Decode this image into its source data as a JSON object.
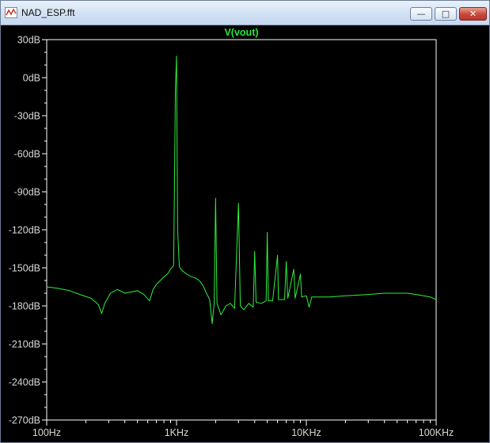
{
  "window": {
    "title": "NAD_ESP.fft",
    "minimize": "—",
    "maximize": "□",
    "close": "✕",
    "icon": "waveform-plot-icon"
  },
  "chart_data": {
    "type": "line",
    "title": "V(vout)",
    "xscale": "log",
    "xlim": [
      100,
      100000
    ],
    "ylim": [
      -270,
      30
    ],
    "xticks": [
      {
        "v": 100,
        "label": "100Hz"
      },
      {
        "v": 1000,
        "label": "1KHz"
      },
      {
        "v": 10000,
        "label": "10KHz"
      },
      {
        "v": 100000,
        "label": "100KHz"
      }
    ],
    "yticks": [
      {
        "v": 30,
        "label": "30dB"
      },
      {
        "v": 0,
        "label": "0dB"
      },
      {
        "v": -30,
        "label": "-30dB"
      },
      {
        "v": -60,
        "label": "-60dB"
      },
      {
        "v": -90,
        "label": "-90dB"
      },
      {
        "v": -120,
        "label": "-120dB"
      },
      {
        "v": -150,
        "label": "-150dB"
      },
      {
        "v": -180,
        "label": "-180dB"
      },
      {
        "v": -210,
        "label": "-210dB"
      },
      {
        "v": -240,
        "label": "-240dB"
      },
      {
        "v": -270,
        "label": "-270dB"
      }
    ],
    "grid": false,
    "series": [
      {
        "name": "V(vout)",
        "color": "#2ef03a",
        "points": [
          [
            100,
            -165
          ],
          [
            120,
            -166
          ],
          [
            150,
            -168
          ],
          [
            180,
            -171
          ],
          [
            220,
            -174
          ],
          [
            250,
            -179
          ],
          [
            265,
            -186
          ],
          [
            280,
            -178
          ],
          [
            310,
            -170
          ],
          [
            350,
            -167
          ],
          [
            400,
            -170
          ],
          [
            450,
            -169
          ],
          [
            500,
            -168
          ],
          [
            560,
            -171
          ],
          [
            620,
            -176
          ],
          [
            660,
            -167
          ],
          [
            700,
            -163
          ],
          [
            750,
            -160
          ],
          [
            800,
            -157
          ],
          [
            850,
            -155
          ],
          [
            900,
            -151
          ],
          [
            950,
            -148
          ],
          [
            980,
            -10
          ],
          [
            1000,
            17
          ],
          [
            1020,
            -120
          ],
          [
            1050,
            -149
          ],
          [
            1100,
            -152
          ],
          [
            1200,
            -155
          ],
          [
            1300,
            -157
          ],
          [
            1400,
            -158
          ],
          [
            1500,
            -160
          ],
          [
            1600,
            -164
          ],
          [
            1700,
            -170
          ],
          [
            1800,
            -175
          ],
          [
            1880,
            -194
          ],
          [
            1950,
            -178
          ],
          [
            2000,
            -95
          ],
          [
            2050,
            -178
          ],
          [
            2200,
            -187
          ],
          [
            2400,
            -180
          ],
          [
            2600,
            -178
          ],
          [
            2800,
            -182
          ],
          [
            3000,
            -99
          ],
          [
            3100,
            -180
          ],
          [
            3300,
            -183
          ],
          [
            3600,
            -178
          ],
          [
            3900,
            -181
          ],
          [
            4000,
            -137
          ],
          [
            4100,
            -177
          ],
          [
            4500,
            -178
          ],
          [
            4900,
            -176
          ],
          [
            5000,
            -122
          ],
          [
            5100,
            -176
          ],
          [
            5500,
            -176
          ],
          [
            6000,
            -140
          ],
          [
            6100,
            -175
          ],
          [
            6800,
            -175
          ],
          [
            7000,
            -145
          ],
          [
            7200,
            -174
          ],
          [
            8000,
            -151
          ],
          [
            8200,
            -174
          ],
          [
            9000,
            -155
          ],
          [
            9200,
            -173
          ],
          [
            10000,
            -172
          ],
          [
            10500,
            -181
          ],
          [
            11000,
            -173
          ],
          [
            13000,
            -173
          ],
          [
            15000,
            -173
          ],
          [
            20000,
            -172
          ],
          [
            30000,
            -171
          ],
          [
            40000,
            -170
          ],
          [
            50000,
            -170
          ],
          [
            60000,
            -170
          ],
          [
            70000,
            -171
          ],
          [
            80000,
            -172
          ],
          [
            90000,
            -173
          ],
          [
            100000,
            -175
          ]
        ]
      }
    ]
  }
}
